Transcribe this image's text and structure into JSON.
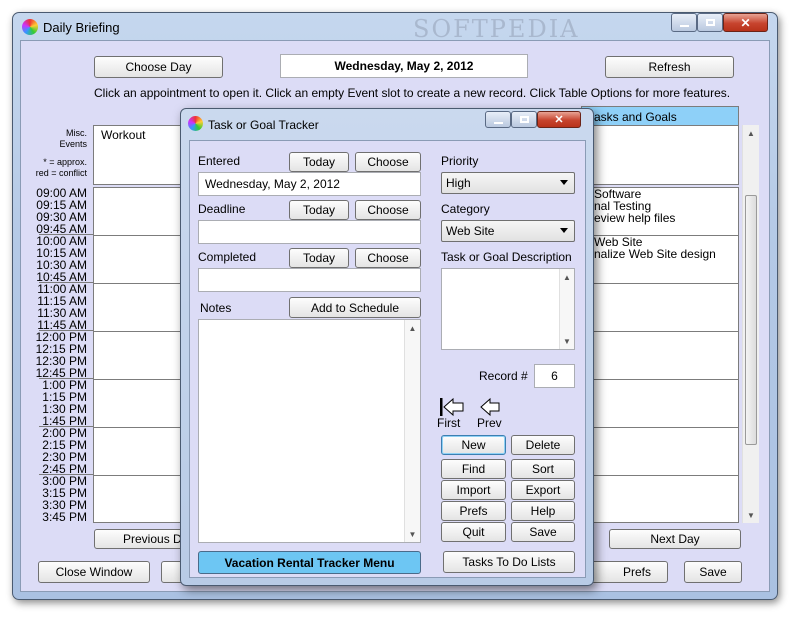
{
  "main_window": {
    "title": "Daily Briefing",
    "watermark": "SOFTPEDIA",
    "choose_day": "Choose Day",
    "date": "Wednesday, May 2, 2012",
    "refresh": "Refresh",
    "instructions": "Click an appointment to open it. Click an empty Event slot to create a new record. Click Table Options for more features.",
    "tasks_header": "asks and Goals",
    "misc_events_label": [
      "Misc.",
      "Events"
    ],
    "legend": [
      "* = approx.",
      "red = conflict"
    ],
    "misc_event": "Workout",
    "times": [
      "09:00 AM",
      "09:15 AM",
      "09:30 AM",
      "09:45 AM",
      "10:00 AM",
      "10:15 AM",
      "10:30 AM",
      "10:45 AM",
      "11:00 AM",
      "11:15 AM",
      "11:30 AM",
      "11:45 AM",
      "12:00 PM",
      "12:15 PM",
      "12:30 PM",
      "12:45 PM",
      "1:00 PM",
      "1:15 PM",
      "1:30 PM",
      "1:45 PM",
      "2:00 PM",
      "2:15 PM",
      "2:30 PM",
      "2:45 PM",
      "3:00 PM",
      "3:15 PM",
      "3:30 PM",
      "3:45 PM"
    ],
    "task_lines": [
      {
        "text": "Software",
        "row": 0
      },
      {
        "text": "nal Testing",
        "row": 1
      },
      {
        "text": "eview help files",
        "row": 2
      },
      {
        "text": "Web Site",
        "row": 4
      },
      {
        "text": "nalize Web Site design",
        "row": 5
      }
    ],
    "previous_day": "Previous D",
    "next_day": "Next Day",
    "close_window": "Close Window",
    "prefs": "Prefs",
    "save": "Save"
  },
  "dialog": {
    "title": "Task or Goal Tracker",
    "entered_label": "Entered",
    "entered_value": "Wednesday, May 2, 2012",
    "deadline_label": "Deadline",
    "deadline_value": "",
    "completed_label": "Completed",
    "completed_value": "",
    "today": "Today",
    "choose": "Choose",
    "notes_label": "Notes",
    "add_to_schedule": "Add to Schedule",
    "notes_value": "",
    "priority_label": "Priority",
    "priority_value": "High",
    "category_label": "Category",
    "category_value": "Web Site",
    "description_label": "Task or Goal Description",
    "description_value": "",
    "record_label": "Record #",
    "record_value": "6",
    "first": "First",
    "prev": "Prev",
    "new": "New",
    "delete": "Delete",
    "find": "Find",
    "sort": "Sort",
    "import": "Import",
    "export": "Export",
    "prefs": "Prefs",
    "help": "Help",
    "quit": "Quit",
    "save": "Save",
    "vacation_menu": "Vacation Rental Tracker Menu",
    "tasks_to_do": "Tasks To Do Lists"
  },
  "colors": {
    "client_bg": "#dcdcf6",
    "header_blue": "#8ed0f8",
    "menu_button": "#6dc6f3"
  }
}
